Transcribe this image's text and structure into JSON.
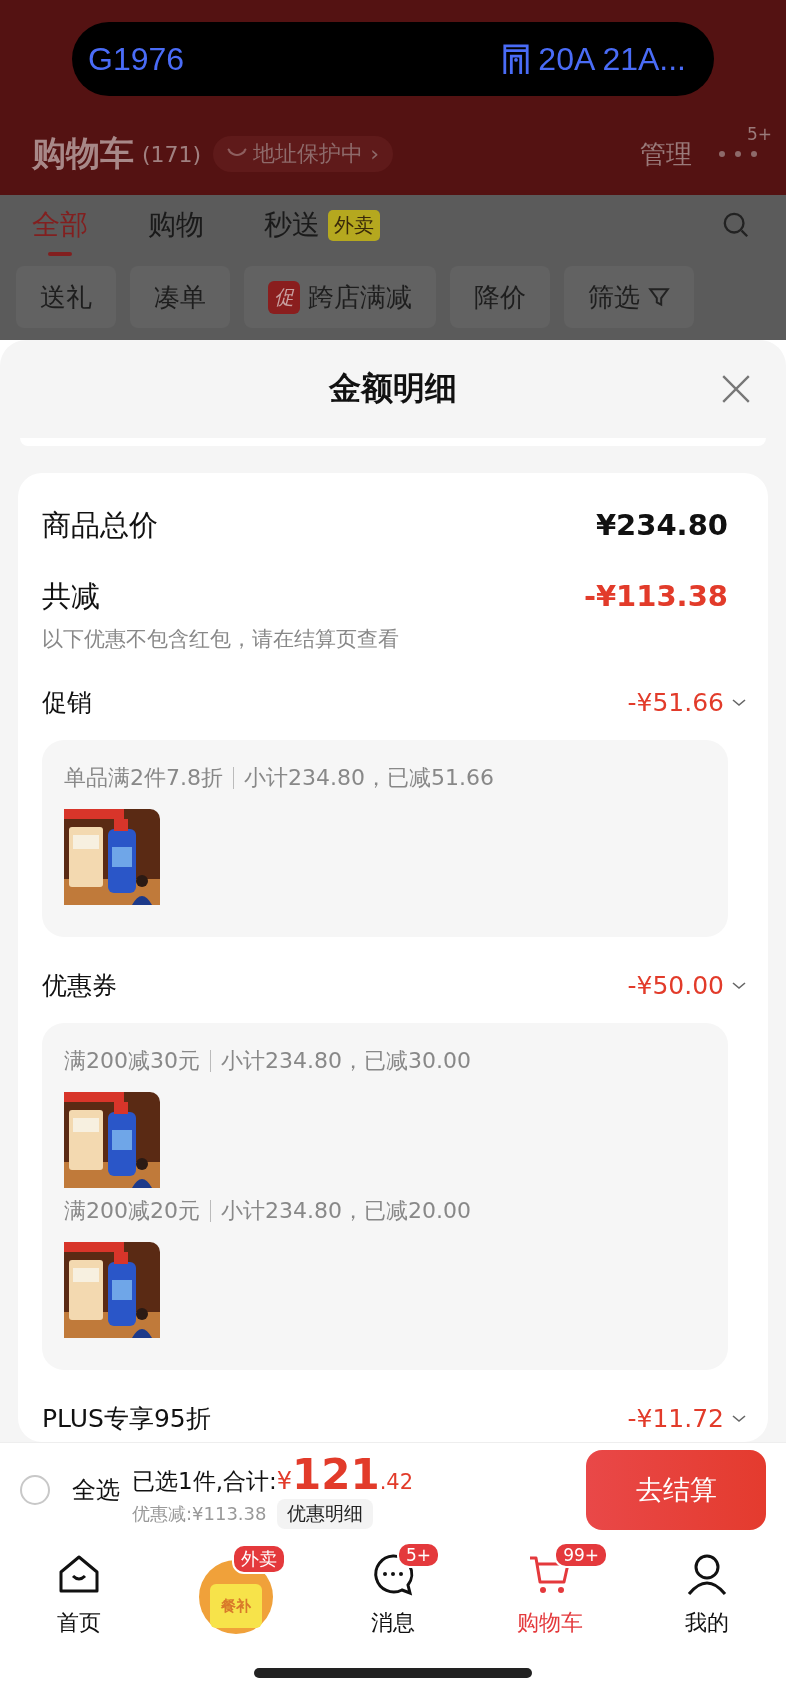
{
  "status_pill": {
    "left": "G1976",
    "right": "20A 21A..."
  },
  "header": {
    "title": "购物车",
    "count": "(171)",
    "address_chip": "地址保护中",
    "chip_arrow": "›",
    "manage": "管理",
    "more_badge": "5+"
  },
  "tabs": [
    {
      "label": "全部",
      "selected": true
    },
    {
      "label": "购物",
      "selected": false
    },
    {
      "label": "秒送",
      "selected": false,
      "tag": "外卖"
    }
  ],
  "chips": [
    {
      "label": "送礼",
      "kind": "plain"
    },
    {
      "label": "凑单",
      "kind": "plain"
    },
    {
      "label": "跨店满减",
      "kind": "badge",
      "badge": "促"
    },
    {
      "label": "降价",
      "kind": "plain"
    },
    {
      "label": "筛选",
      "kind": "filter"
    }
  ],
  "sheet": {
    "title": "金额明细",
    "total": {
      "label": "商品总价",
      "value": "¥234.80"
    },
    "reduction": {
      "label": "共减",
      "value": "-¥113.38",
      "note": "以下优惠不包含红包，请在结算页查看"
    },
    "sections": [
      {
        "label": "促销",
        "value": "-¥51.66",
        "details": [
          {
            "rule": "单品满2件7.8折",
            "subtotal": "小计234.80，已减51.66"
          }
        ]
      },
      {
        "label": "优惠券",
        "value": "-¥50.00",
        "details": [
          {
            "rule": "满200减30元",
            "subtotal": "小计234.80，已减30.00"
          },
          {
            "rule": "满200减20元",
            "subtotal": "小计234.80，已减20.00"
          }
        ]
      },
      {
        "label": "PLUS专享95折",
        "value": "-¥11.72"
      }
    ]
  },
  "bottom_bar": {
    "select_all": {
      "label": "全选",
      "checked": false
    },
    "summary": "已选1件,合计:",
    "currency": "¥",
    "amount_int": "121",
    "amount_dec": ".42",
    "discount": "优惠减:¥113.38",
    "detail_button": "优惠明细",
    "checkout": "去结算"
  },
  "tab_bar": [
    {
      "kind": "home",
      "label": "首页",
      "selected": false
    },
    {
      "kind": "promo",
      "tag": "外卖",
      "text": "餐补"
    },
    {
      "kind": "message",
      "label": "消息",
      "badge": "5+",
      "selected": false
    },
    {
      "kind": "cart",
      "label": "购物车",
      "badge": "99+",
      "selected": true
    },
    {
      "kind": "profile",
      "label": "我的",
      "selected": false
    }
  ]
}
